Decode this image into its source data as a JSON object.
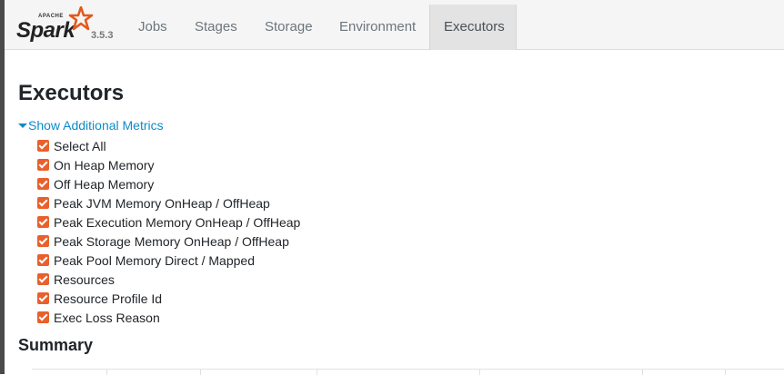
{
  "nav": {
    "brand_apache": "APACHE",
    "brand_name": "Spark",
    "version": "3.5.3",
    "tabs": [
      {
        "label": "Jobs"
      },
      {
        "label": "Stages"
      },
      {
        "label": "Storage"
      },
      {
        "label": "Environment"
      },
      {
        "label": "Executors",
        "active": true
      }
    ]
  },
  "page": {
    "title": "Executors",
    "metrics_toggle": "Show Additional Metrics",
    "metrics": [
      {
        "label": "Select All",
        "checked": true
      },
      {
        "label": "On Heap Memory",
        "checked": true
      },
      {
        "label": "Off Heap Memory",
        "checked": true
      },
      {
        "label": "Peak JVM Memory OnHeap / OffHeap",
        "checked": true
      },
      {
        "label": "Peak Execution Memory OnHeap / OffHeap",
        "checked": true
      },
      {
        "label": "Peak Storage Memory OnHeap / OffHeap",
        "checked": true
      },
      {
        "label": "Peak Pool Memory Direct / Mapped",
        "checked": true
      },
      {
        "label": "Resources",
        "checked": true
      },
      {
        "label": "Resource Profile Id",
        "checked": true
      },
      {
        "label": "Exec Loss Reason",
        "checked": true
      }
    ],
    "summary_title": "Summary"
  },
  "colors": {
    "checkbox": "#e8602c",
    "link": "#0d8bc8",
    "navbar_bg": "#f5f5f5",
    "active_tab_bg": "#e3e3e3"
  }
}
